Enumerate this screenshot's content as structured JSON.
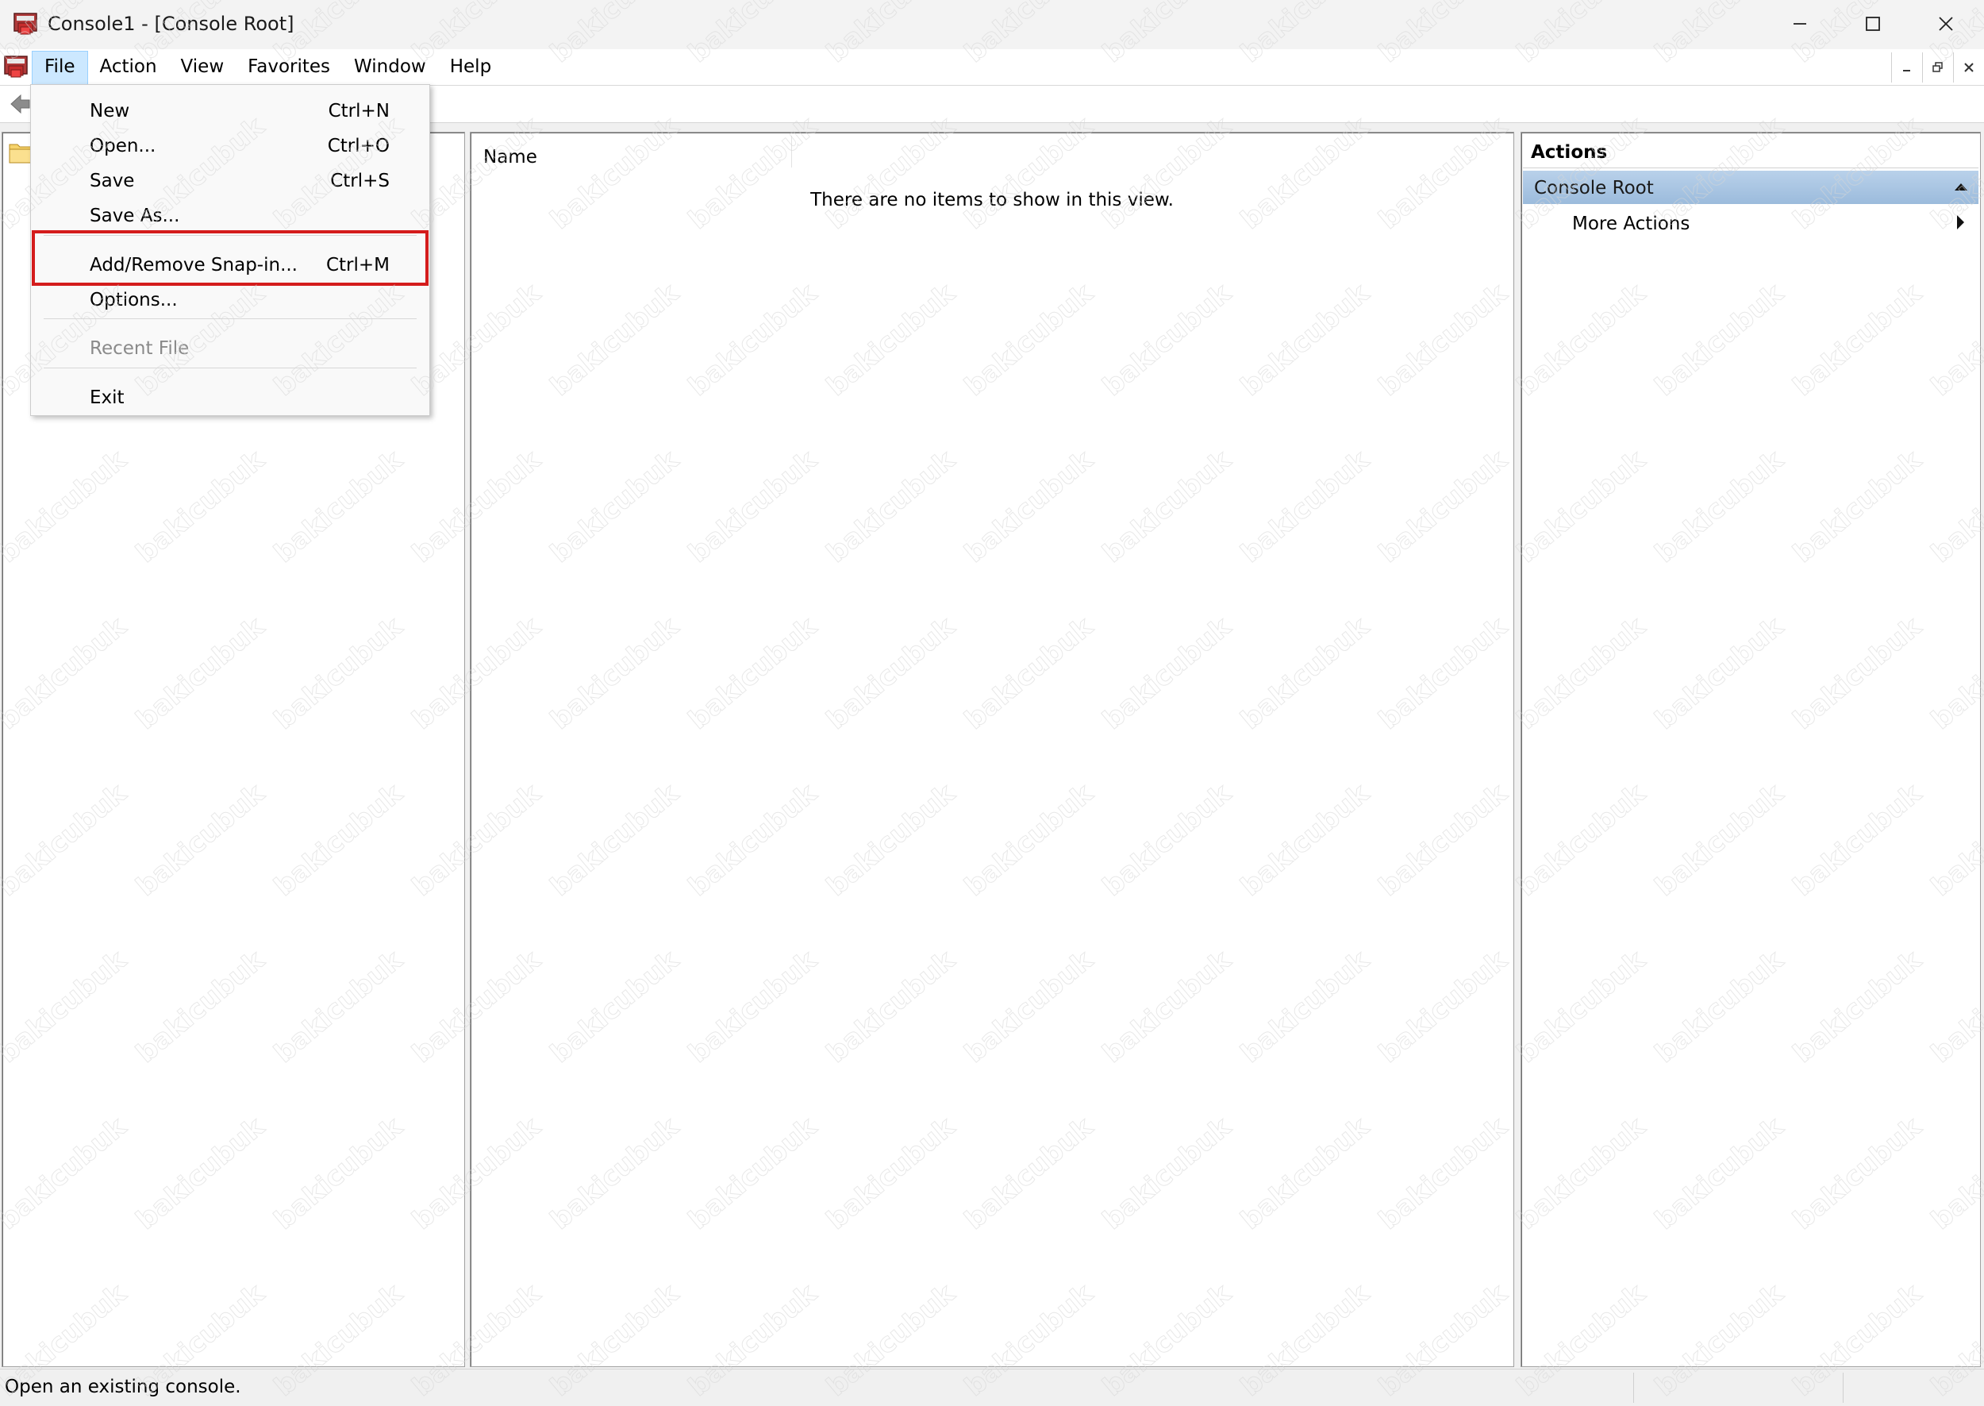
{
  "window": {
    "title": "Console1 - [Console Root]"
  },
  "menubar": {
    "items": [
      "File",
      "Action",
      "View",
      "Favorites",
      "Window",
      "Help"
    ],
    "open_item": "File"
  },
  "file_menu": {
    "new": {
      "label": "New",
      "shortcut": "Ctrl+N"
    },
    "open": {
      "label": "Open...",
      "shortcut": "Ctrl+O"
    },
    "save": {
      "label": "Save",
      "shortcut": "Ctrl+S"
    },
    "save_as": {
      "label": "Save As..."
    },
    "add_remove": {
      "label": "Add/Remove Snap-in...",
      "shortcut": "Ctrl+M"
    },
    "options": {
      "label": "Options..."
    },
    "recent_file": {
      "label": "Recent File"
    },
    "exit": {
      "label": "Exit"
    }
  },
  "center": {
    "column_name": "Name",
    "empty_message": "There are no items to show in this view."
  },
  "actions": {
    "title": "Actions",
    "group": "Console Root",
    "more_actions": "More Actions"
  },
  "status": {
    "text": "Open an existing console."
  },
  "watermark": {
    "text": "bakicubuk"
  },
  "colors": {
    "highlight_border": "#d41c1c",
    "menu_open_bg": "#cce8ff",
    "actions_group_bg": "#a7c3e0"
  }
}
